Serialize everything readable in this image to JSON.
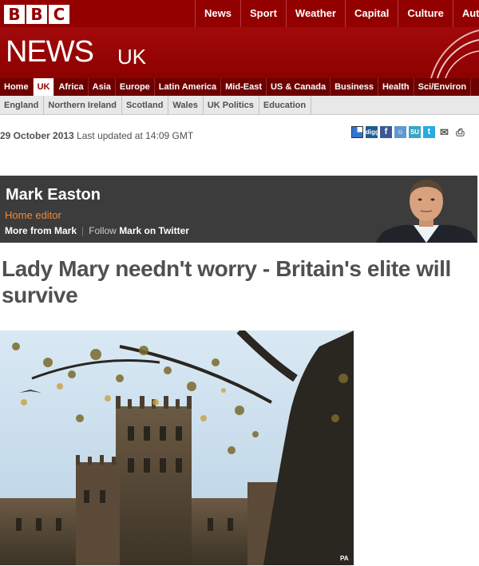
{
  "masthead": {
    "logo_letters": [
      "B",
      "B",
      "C"
    ],
    "nav": [
      "News",
      "Sport",
      "Weather",
      "Capital",
      "Culture",
      "Auto"
    ]
  },
  "banner": {
    "news": "NEWS",
    "edition": "UK"
  },
  "section_nav": {
    "items": [
      "Home",
      "UK",
      "Africa",
      "Asia",
      "Europe",
      "Latin America",
      "Mid-East",
      "US & Canada",
      "Business",
      "Health",
      "Sci/Environ"
    ],
    "active": "UK"
  },
  "sub_nav": {
    "items": [
      "England",
      "Northern Ireland",
      "Scotland",
      "Wales",
      "UK Politics",
      "Education"
    ]
  },
  "article": {
    "date": "29 October 2013",
    "updated": "Last updated at 14:09 GMT",
    "headline": "Lady Mary needn't worry - Britain's elite will survive",
    "photo_credit": "PA"
  },
  "share_icons": [
    {
      "name": "delicious-icon",
      "label": "",
      "color": "#3274d0"
    },
    {
      "name": "digg-icon",
      "label": "digg",
      "color": "#1f5c91"
    },
    {
      "name": "facebook-icon",
      "label": "f",
      "color": "#3b5998"
    },
    {
      "name": "reddit-icon",
      "label": "r",
      "color": "#5f99cf"
    },
    {
      "name": "stumbleupon-icon",
      "label": "SU",
      "color": "#3aa4c6"
    },
    {
      "name": "twitter-icon",
      "label": "t",
      "color": "#2aa9e0"
    },
    {
      "name": "email-icon",
      "label": "",
      "color": "#555555"
    },
    {
      "name": "print-icon",
      "label": "",
      "color": "#555555"
    }
  ],
  "author": {
    "name": "Mark Easton",
    "role": "Home editor",
    "more_link": "More from Mark",
    "follow_pre": "Follow",
    "follow_link": "Mark on Twitter"
  },
  "colors": {
    "brand_red": "#930000",
    "section_nav": "#6e0000",
    "author_bg": "#3c3c3c",
    "author_role": "#ef8a3a"
  }
}
